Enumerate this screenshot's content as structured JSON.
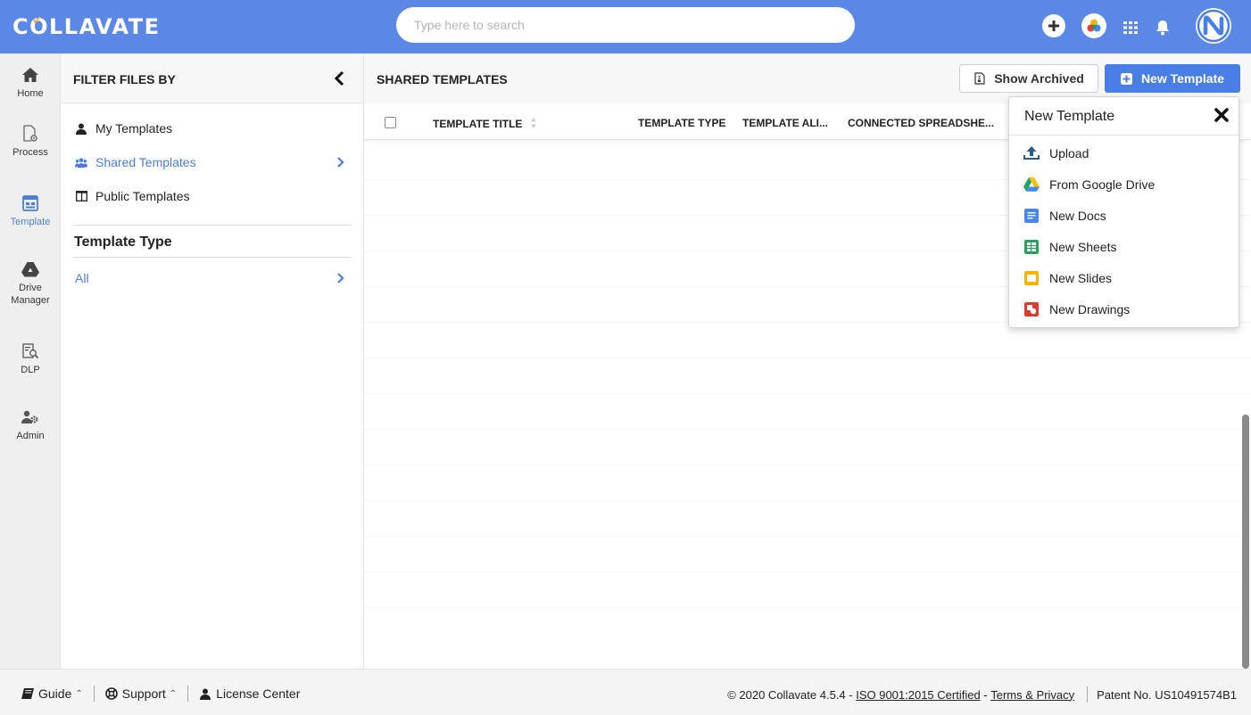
{
  "app": {
    "logo_text": "COLLAVATE",
    "search_placeholder": "Type here to search"
  },
  "leftnav": [
    {
      "label": "Home",
      "icon": "home-icon"
    },
    {
      "label": "Process",
      "icon": "process-icon"
    },
    {
      "label": "Template",
      "icon": "template-icon",
      "active": true
    },
    {
      "label": "Drive Manager",
      "icon": "drive-icon"
    },
    {
      "label": "DLP",
      "icon": "dlp-icon"
    },
    {
      "label": "Admin",
      "icon": "admin-icon"
    }
  ],
  "filter": {
    "title": "FILTER FILES BY",
    "items": [
      {
        "label": "My Templates",
        "icon": "user-icon"
      },
      {
        "label": "Shared Templates",
        "icon": "users-icon",
        "active": true
      },
      {
        "label": "Public Templates",
        "icon": "columns-icon"
      }
    ],
    "type_title": "Template Type",
    "type_items": [
      {
        "label": "All",
        "active": true
      }
    ]
  },
  "main": {
    "title": "SHARED TEMPLATES",
    "show_archived_label": "Show Archived",
    "new_template_label": "New Template",
    "columns": [
      "TEMPLATE TITLE",
      "TEMPLATE TYPE",
      "TEMPLATE ALI...",
      "CONNECTED SPREADSHE..."
    ]
  },
  "dropdown": {
    "title": "New Template",
    "items": [
      {
        "label": "Upload",
        "icon": "upload-icon"
      },
      {
        "label": "From Google Drive",
        "icon": "google-drive-icon"
      },
      {
        "label": "New Docs",
        "icon": "google-docs-icon"
      },
      {
        "label": "New Sheets",
        "icon": "google-sheets-icon"
      },
      {
        "label": "New Slides",
        "icon": "google-slides-icon"
      },
      {
        "label": "New Drawings",
        "icon": "google-drawings-icon"
      }
    ]
  },
  "footer": {
    "guide": "Guide",
    "support": "Support",
    "license": "License Center",
    "copyright": "© 2020 Collavate 4.5.4 - ",
    "iso": "ISO 9001:2015 Certified",
    "dash": " - ",
    "terms": "Terms & Privacy",
    "patent": "Patent No. US10491574B1"
  },
  "colors": {
    "topbar": "#5b87e7",
    "accent": "#4a7ed8",
    "primary_button": "#4a7ee7"
  }
}
